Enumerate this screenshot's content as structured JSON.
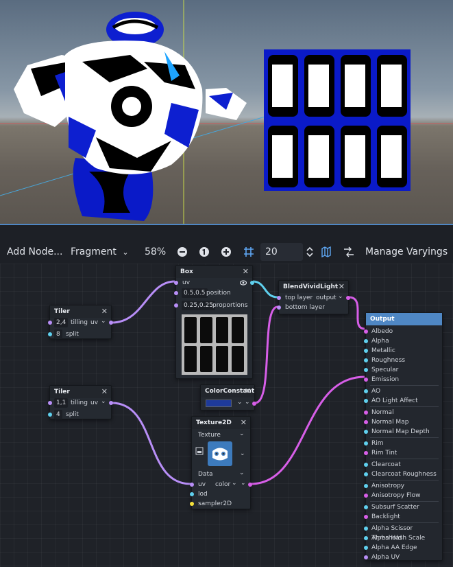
{
  "toolbar": {
    "add_node": "Add Node...",
    "mode": "Fragment",
    "zoom": "58%",
    "snap_distance": "20",
    "manage_varyings": "Manage Varyings"
  },
  "nodes": {
    "box": {
      "title": "Box",
      "port_uv": "uv",
      "position_value": "0.5,0.5",
      "position_label": "position",
      "proportions_value": "0.25,0.25",
      "proportions_label": "proportions"
    },
    "blend": {
      "title": "BlendVividLight",
      "top_layer": "top layer",
      "output": "output",
      "bottom_layer": "bottom layer"
    },
    "tiler1": {
      "title": "Tiler",
      "tilling_value": "2,4",
      "tilling_label": "tilling",
      "uv_label": "uv",
      "split_value": "8",
      "split_label": "split"
    },
    "tiler2": {
      "title": "Tiler",
      "tilling_value": "1,1",
      "tilling_label": "tilling",
      "uv_label": "uv",
      "split_value": "4",
      "split_label": "split"
    },
    "color_constant": {
      "title": "ColorConstant",
      "color": "#1e3a9a"
    },
    "texture2d": {
      "title": "Texture2D",
      "source": "Texture",
      "type": "Data",
      "uv": "uv",
      "color": "color",
      "lod": "lod",
      "sampler": "sampler2D"
    },
    "output": {
      "title": "Output",
      "ports": [
        "Albedo",
        "Alpha",
        "Metallic",
        "Roughness",
        "Specular",
        "Emission",
        "AO",
        "AO Light Affect",
        "Normal",
        "Normal Map",
        "Normal Map Depth",
        "Rim",
        "Rim Tint",
        "Clearcoat",
        "Clearcoat Roughness",
        "Anisotropy",
        "Anisotropy Flow",
        "Subsurf Scatter",
        "Backlight",
        "Alpha Scissor Threshold",
        "Alpha Hash Scale",
        "Alpha AA Edge",
        "Alpha UV"
      ]
    }
  },
  "colors": {
    "accent": "#4f87c4",
    "wire_vector": "#b88ef7",
    "wire_color": "#d75ee8",
    "wire_scalar": "#5fd0ee"
  }
}
